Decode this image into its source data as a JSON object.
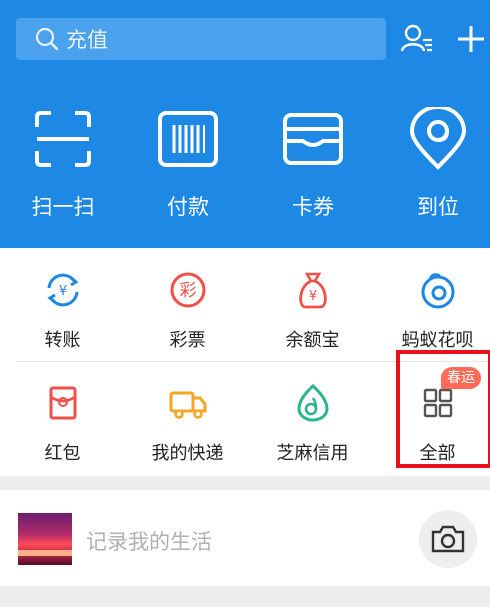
{
  "search": {
    "placeholder": "充值"
  },
  "quick_actions": [
    {
      "label": "扫一扫",
      "icon": "scan-icon"
    },
    {
      "label": "付款",
      "icon": "barcode-icon"
    },
    {
      "label": "卡券",
      "icon": "wallet-icon"
    },
    {
      "label": "到位",
      "icon": "location-pin-icon"
    }
  ],
  "services_row1": [
    {
      "label": "转账",
      "icon": "transfer-icon"
    },
    {
      "label": "彩票",
      "icon": "lottery-icon"
    },
    {
      "label": "余额宝",
      "icon": "money-bag-icon"
    },
    {
      "label": "蚂蚁花呗",
      "icon": "huabei-icon"
    }
  ],
  "services_row2": [
    {
      "label": "红包",
      "icon": "red-envelope-icon"
    },
    {
      "label": "我的快递",
      "icon": "delivery-truck-icon"
    },
    {
      "label": "芝麻信用",
      "icon": "sesame-credit-icon"
    },
    {
      "label": "全部",
      "icon": "grid-icon"
    }
  ],
  "badge": "春运",
  "life": {
    "placeholder": "记录我的生活"
  },
  "colors": {
    "header": "#1e88e5",
    "blue": "#1e88e5",
    "red": "#f0504a",
    "orange": "#f5a623",
    "green": "#2bb58e",
    "highlight": "#e8101a"
  }
}
